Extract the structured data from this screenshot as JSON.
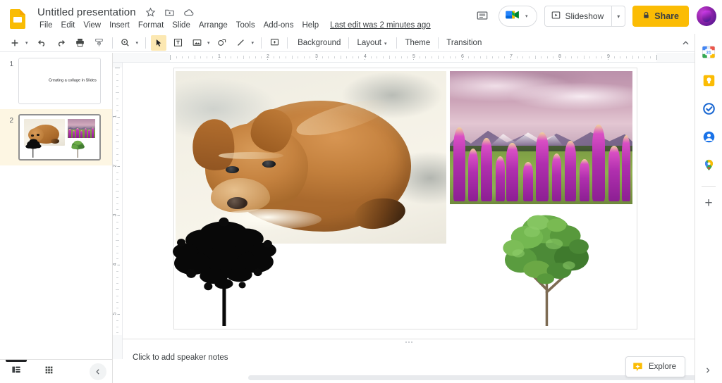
{
  "app": {
    "name": "Google Slides",
    "logo_icon": "slides-logo-icon",
    "brand_color": "#fbbc04",
    "accent_color": "#1a73e8"
  },
  "titlebar": {
    "doc_title": "Untitled presentation",
    "icons": [
      {
        "name": "star-icon",
        "glyph": "☆"
      },
      {
        "name": "move-to-folder-icon",
        "glyph": "❐"
      },
      {
        "name": "cloud-saved-icon",
        "glyph": "☁"
      }
    ],
    "menus": [
      {
        "label": "File"
      },
      {
        "label": "Edit"
      },
      {
        "label": "View"
      },
      {
        "label": "Insert"
      },
      {
        "label": "Format"
      },
      {
        "label": "Slide"
      },
      {
        "label": "Arrange"
      },
      {
        "label": "Tools"
      },
      {
        "label": "Add-ons"
      },
      {
        "label": "Help"
      }
    ],
    "last_edit": "Last edit was 2 minutes ago",
    "comment_icon": "comment-history-icon",
    "meet_icon": "google-meet-icon",
    "slideshow_label": "Slideshow",
    "slideshow_icon": "present-icon",
    "share_label": "Share",
    "share_icon": "lock-icon",
    "avatar_name": "user-avatar"
  },
  "toolbar": {
    "items": [
      {
        "name": "new-slide-button",
        "icon": "plus-icon",
        "caret": true
      },
      {
        "name": "undo-button",
        "icon": "undo-icon",
        "caret": false
      },
      {
        "name": "redo-button",
        "icon": "redo-icon",
        "caret": false
      },
      {
        "name": "print-button",
        "icon": "printer-icon",
        "caret": false
      },
      {
        "name": "paint-format-button",
        "icon": "paint-format-icon",
        "caret": false
      },
      {
        "name": "zoom-button",
        "icon": "zoom-icon",
        "caret": true
      },
      {
        "name": "select-tool-button",
        "icon": "cursor-icon",
        "caret": false,
        "active": true
      },
      {
        "name": "text-box-button",
        "icon": "text-box-icon",
        "caret": false
      },
      {
        "name": "insert-image-button",
        "icon": "image-icon",
        "caret": true
      },
      {
        "name": "shape-button",
        "icon": "shape-icon",
        "caret": false
      },
      {
        "name": "line-button",
        "icon": "line-icon",
        "caret": true
      },
      {
        "name": "insert-comment-button",
        "icon": "add-comment-icon",
        "caret": false
      }
    ],
    "text_buttons": [
      {
        "name": "background-button",
        "label": "Background"
      },
      {
        "name": "layout-button",
        "label": "Layout",
        "caret": true
      },
      {
        "name": "theme-button",
        "label": "Theme"
      },
      {
        "name": "transition-button",
        "label": "Transition"
      }
    ],
    "collapse_icon": "chevron-up-icon"
  },
  "filmstrip": {
    "slides": [
      {
        "number": "1",
        "selected": false,
        "title_text": "Creating a collage in Slides",
        "kind": "title"
      },
      {
        "number": "2",
        "selected": true,
        "title_text": "",
        "kind": "collage"
      }
    ]
  },
  "rulers": {
    "horizontal_numbers": [
      "1",
      "2",
      "3",
      "4",
      "5",
      "6",
      "7",
      "8",
      "9"
    ],
    "vertical_numbers": [
      "1",
      "2",
      "3",
      "4",
      "5"
    ],
    "unit": "inches"
  },
  "canvas": {
    "slide_number": 2,
    "background_color": "#ffffff",
    "objects": [
      {
        "name": "image-puppy-on-sand",
        "kind": "photo",
        "subject": "sleeping tan puppy curled up on white sand",
        "position": "top-left"
      },
      {
        "name": "image-lupin-field",
        "kind": "photo",
        "subject": "purple lupin flower field with mountains and pink clouds",
        "position": "top-right"
      },
      {
        "name": "image-black-tree-silhouette",
        "kind": "cutout",
        "subject": "black silhouette of a bare tree",
        "position": "bottom-left"
      },
      {
        "name": "image-green-tree",
        "kind": "cutout",
        "subject": "green leafy tree cutout",
        "position": "bottom-right"
      }
    ]
  },
  "notes": {
    "placeholder": "Click to add speaker notes"
  },
  "bottombar": {
    "buttons": [
      {
        "name": "filmstrip-view-button",
        "icon": "filmstrip-icon",
        "active": true
      },
      {
        "name": "grid-view-button",
        "icon": "grid-icon",
        "active": false
      }
    ],
    "collapse_icon": "chevron-left-icon",
    "collapse_name": "hide-filmstrip-button"
  },
  "explore": {
    "label": "Explore",
    "icon": "explore-icon"
  },
  "right_rail": {
    "icons": [
      {
        "name": "google-calendar-icon",
        "label": "Calendar"
      },
      {
        "name": "google-keep-icon",
        "label": "Keep"
      },
      {
        "name": "google-tasks-icon",
        "label": "Tasks"
      },
      {
        "name": "google-contacts-icon",
        "label": "Contacts"
      },
      {
        "name": "google-maps-icon",
        "label": "Maps"
      }
    ],
    "add_label": "+",
    "add_name": "get-add-ons-button",
    "expand_icon": "chevron-right-icon"
  }
}
